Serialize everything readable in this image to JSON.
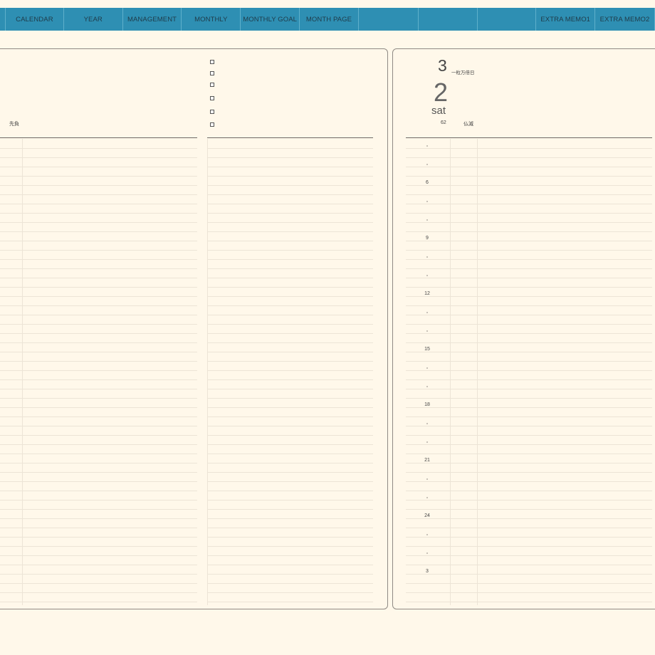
{
  "nav": {
    "tabs": [
      {
        "label": "",
        "width": 8
      },
      {
        "label": "CALENDAR",
        "width": 82
      },
      {
        "label": "YEAR",
        "width": 83
      },
      {
        "label": "MANAGEMENT",
        "width": 83
      },
      {
        "label": "MONTHLY",
        "width": 83
      },
      {
        "label": "MONTHLY GOAL",
        "width": 83
      },
      {
        "label": "MONTH PAGE",
        "width": 83
      },
      {
        "label": "",
        "width": 84
      },
      {
        "label": "",
        "width": 83
      },
      {
        "label": "",
        "width": 83
      },
      {
        "label": "EXTRA MEMO1",
        "width": 83
      },
      {
        "label": "EXTRA MEMO2",
        "width": 84
      }
    ]
  },
  "left_page": {
    "label": "先負"
  },
  "right_page": {
    "month": "3",
    "month_note": "一粒万倍日",
    "day": "2",
    "weekday": "sat",
    "day_of_year": "62",
    "rokuyo": "仏滅",
    "hours": [
      "6",
      "9",
      "12",
      "15",
      "18",
      "21",
      "24",
      "3"
    ]
  },
  "colors": {
    "nav_bg": "#2e8fb3",
    "paper": "#fff8ea",
    "border": "#8f8a84"
  }
}
